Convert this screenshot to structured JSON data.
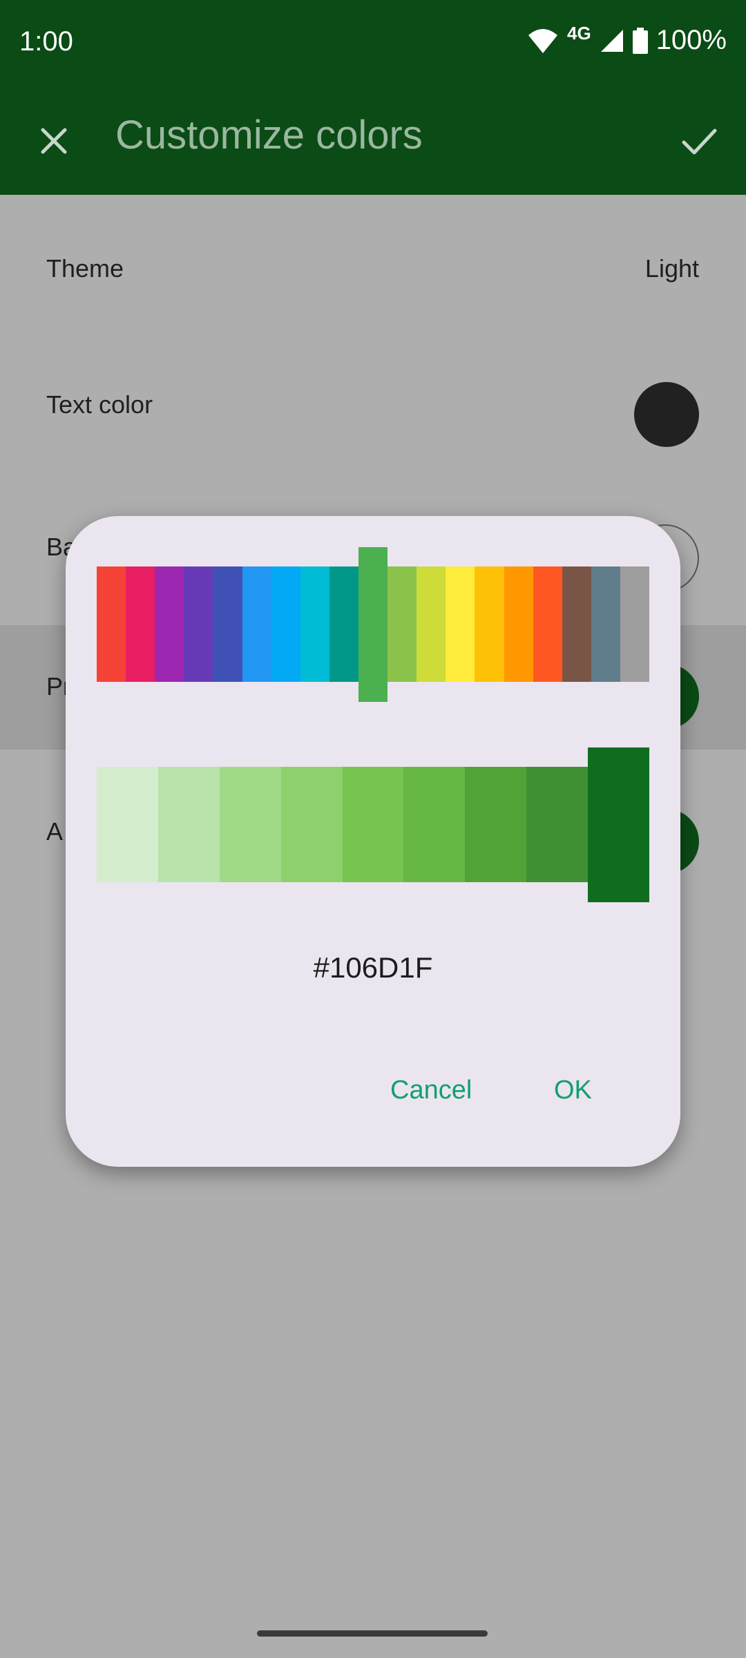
{
  "status": {
    "time": "1:00",
    "network": "4G",
    "battery": "100%"
  },
  "appbar": {
    "title": "Customize colors",
    "close_icon": "close-icon",
    "confirm_icon": "check-icon"
  },
  "settings": [
    {
      "label": "Theme",
      "value": "Light"
    },
    {
      "label": "Text color",
      "swatch": "#212121"
    },
    {
      "label": "Ba",
      "swatch": "#bdbdbd"
    },
    {
      "label": "Pr",
      "swatch": "#0b4b16"
    },
    {
      "label": "A",
      "swatch": "#0b4b16"
    }
  ],
  "dialog": {
    "palette": [
      "#F44336",
      "#E91E63",
      "#9C27B0",
      "#673AB7",
      "#3F51B5",
      "#2196F3",
      "#03A9F4",
      "#00BCD4",
      "#009688",
      "#4CAF50",
      "#8BC34A",
      "#CDDC39",
      "#FFEB3B",
      "#FFC107",
      "#FF9800",
      "#FF5722",
      "#795548",
      "#607D8B",
      "#9E9E9E"
    ],
    "palette_selected_index": 9,
    "shades": [
      "#D4EDCC",
      "#B8E3AA",
      "#A1DA86",
      "#8ED06C",
      "#78C451",
      "#66B744",
      "#53A238",
      "#3F8F33",
      "#106D1F"
    ],
    "shades_selected_index": 8,
    "hex": "#106D1F",
    "cancel_label": "Cancel",
    "ok_label": "OK"
  }
}
